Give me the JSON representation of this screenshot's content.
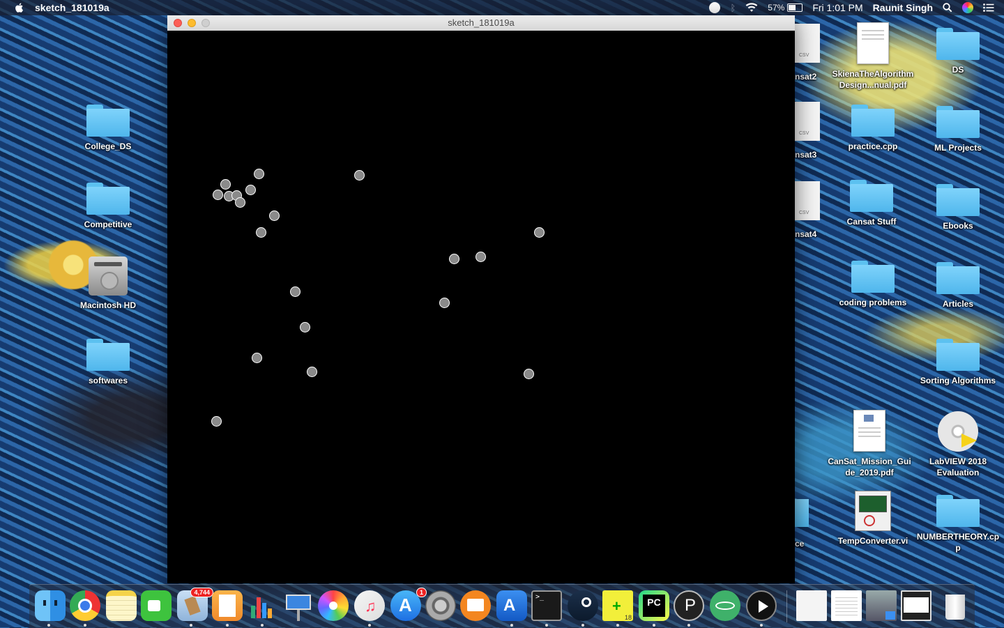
{
  "menubar": {
    "app_name": "sketch_181019a",
    "battery": "57%",
    "clock": "Fri 1:01 PM",
    "user": "Raunit Singh"
  },
  "window": {
    "title": "sketch_181019a",
    "canvas_background": "#000000"
  },
  "desktop_left": [
    {
      "label": "College_DS",
      "kind": "folder"
    },
    {
      "label": "Competitive",
      "kind": "folder"
    },
    {
      "label": "Macintosh HD",
      "kind": "drive"
    },
    {
      "label": "softwares",
      "kind": "folder"
    }
  ],
  "desktop_partial": [
    {
      "label": "nsat2",
      "badge": "CSV"
    },
    {
      "label": "nsat3",
      "badge": "CSV"
    },
    {
      "label": "nsat4",
      "badge": "CSV"
    },
    {
      "label": "ce",
      "badge": ""
    }
  ],
  "desktop_col1": [
    {
      "label": "SkienaTheAlgorithmDesign...nual.pdf",
      "kind": "pdf"
    },
    {
      "label": "practice.cpp",
      "kind": "folder"
    },
    {
      "label": "Cansat Stuff",
      "kind": "folder"
    },
    {
      "label": "coding problems",
      "kind": "folder"
    },
    {
      "label": "CanSat_Mission_Guide_2019.pdf",
      "kind": "pdf"
    },
    {
      "label": "TempConverter.vi",
      "kind": "vi"
    }
  ],
  "desktop_col2": [
    {
      "label": "DS",
      "kind": "folder"
    },
    {
      "label": "ML Projects",
      "kind": "folder"
    },
    {
      "label": "Ebooks",
      "kind": "folder"
    },
    {
      "label": "Articles",
      "kind": "folder"
    },
    {
      "label": "Sorting Algorithms",
      "kind": "folder"
    },
    {
      "label": "LabVIEW 2018 Evaluation",
      "kind": "disc"
    },
    {
      "label": "NUMBERTHEORY.cpp",
      "kind": "folder"
    }
  ],
  "dock": {
    "apps": [
      "Finder",
      "Chrome",
      "Notes",
      "FaceTime",
      "Mail",
      "Pages",
      "Numbers",
      "Keynote",
      "Photos",
      "iTunes",
      "App Store",
      "System Preferences",
      "iBooks",
      "Xcode",
      "Terminal",
      "Steam",
      "LabVIEW",
      "PyCharm",
      "Processing",
      "Atom",
      "QuickTime"
    ],
    "mail_badge": "4,744",
    "appstore_badge": "1",
    "labview_version": "18"
  },
  "colors": {
    "menubar": "#1f2638",
    "dot_fill": "#8a8a8a",
    "dot_stroke": "#ffffff",
    "folder_blue": "#6cc9f6"
  }
}
